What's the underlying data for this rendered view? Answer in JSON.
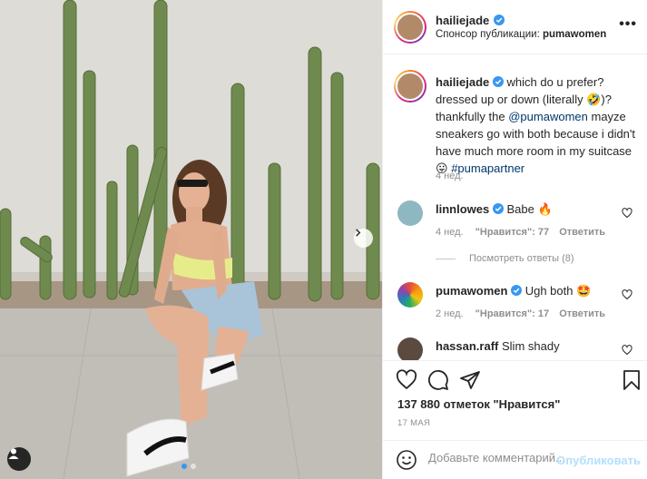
{
  "post": {
    "author": "hailiejade",
    "sponsor_prefix": "Спонсор публикации:",
    "sponsor_name": "pumawomen",
    "more_label": "•••"
  },
  "caption": {
    "author": "hailiejade",
    "text_1": "which do u prefer? dressed up or down (literally 🤣)? thankfully the",
    "mention": "@pumawomen",
    "text_2": "mayze sneakers go with both because i didn't have much more room in my suitcase 😛",
    "hashtag": "#pumapartner",
    "age": "4 нед."
  },
  "comments": [
    {
      "author": "linnlowes",
      "text": "Babe 🔥",
      "age": "4 нед.",
      "likes": "\"Нравится\": 77",
      "reply": "Ответить"
    },
    {
      "author": "pumawomen",
      "text": "Ugh both 🤩",
      "age": "2 нед.",
      "likes": "\"Нравится\": 17",
      "reply": "Ответить"
    },
    {
      "author": "hassan.raff",
      "text": "Slim shady"
    }
  ],
  "view_replies": "Посмотреть ответы (8)",
  "likes_count": "137 880 отметок \"Нравится\"",
  "date": "17 МАЯ",
  "add_comment": {
    "placeholder": "Добавьте комментарий...",
    "publish_label": "Опубликовать"
  },
  "colors": {
    "accent": "#3897f0",
    "link": "#00376b",
    "verified": "#3897f0",
    "muted": "#8e8e8e",
    "publish_disabled": "#b2dffc"
  },
  "icons": [
    "heart-icon",
    "comment-icon",
    "share-icon",
    "bookmark-icon",
    "emoji-icon",
    "chevron-right-icon",
    "user-tag-icon",
    "verified-icon"
  ]
}
